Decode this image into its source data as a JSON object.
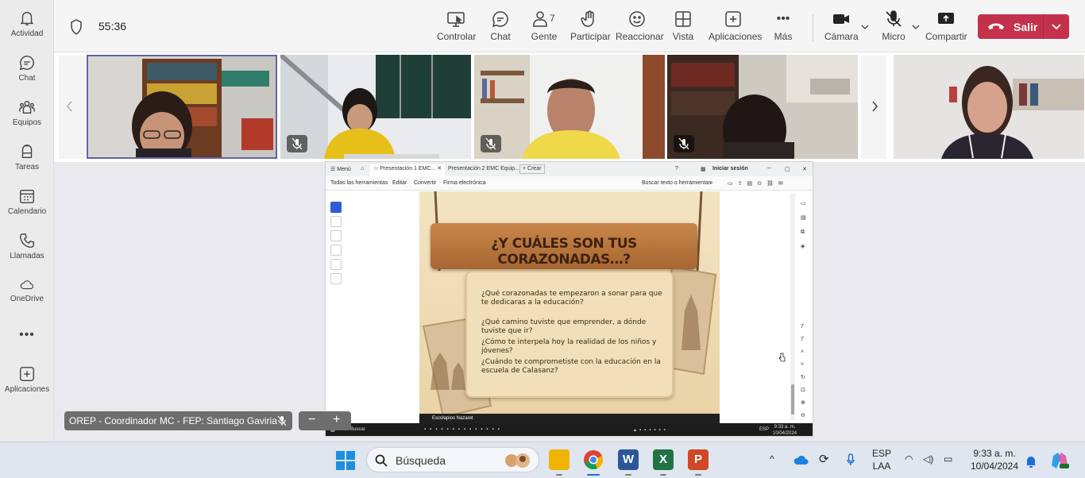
{
  "rail": {
    "items": [
      {
        "label": "Actividad",
        "icon": "bell-icon"
      },
      {
        "label": "Chat",
        "icon": "chat-icon"
      },
      {
        "label": "Equipos",
        "icon": "teams-icon"
      },
      {
        "label": "Tareas",
        "icon": "backpack-icon"
      },
      {
        "label": "Calendario",
        "icon": "calendar-icon"
      },
      {
        "label": "Llamadas",
        "icon": "phone-icon"
      },
      {
        "label": "OneDrive",
        "icon": "cloud-icon"
      },
      {
        "label": "",
        "icon": "more-icon"
      },
      {
        "label": "Aplicaciones",
        "icon": "add-app-icon"
      }
    ]
  },
  "topbar": {
    "timer": "55:36",
    "buttons": {
      "controlar": "Controlar",
      "chat": "Chat",
      "gente": "Gente",
      "gente_count": "7",
      "participar": "Participar",
      "reaccionar": "Reaccionar",
      "vista": "Vista",
      "aplicaciones": "Aplicaciones",
      "mas": "Más",
      "camara": "Cámara",
      "micro": "Micro",
      "compartir": "Compartir"
    },
    "leave": "Salir",
    "accent": "#c4314b"
  },
  "share": {
    "tabs": {
      "menu": "Menú",
      "tab1": "Presentación 1 EMC...",
      "tab2": "Presentación 2 EMC Equip...",
      "create": "Crear",
      "signin": "Iniciar sesión"
    },
    "menu": {
      "all_tools": "Todas las herramientas",
      "edit": "Editar",
      "convert": "Convertir",
      "esign": "Firma electrónica",
      "find": "Buscar texto o herramientas"
    },
    "slide": {
      "title": "¿Y CUÁLES SON TUS CORAZONADAS…?",
      "questions": [
        "¿Qué corazonadas te empezaron a sonar para que te dedicaras a la educación?",
        "¿Qué camino tuviste que emprender, a dónde tuviste que ir?",
        "¿Cómo te interpela hoy la realidad de los niños y jóvenes?",
        "¿Cuándo te comprometiste con la educación en la escuela de Calasanz?"
      ],
      "footer": "Escolapios Nazaret"
    },
    "taskbar": {
      "search": "Buscar",
      "time": "9:33 a. m.",
      "date": "10/04/2024",
      "lang": "ESP"
    }
  },
  "nameplate": {
    "name": "OREP - Coordinador MC - FEP: Santiago Gaviria"
  },
  "zoom": {
    "minus": "−",
    "plus": "+"
  },
  "taskbar": {
    "search_placeholder": "Búsqueda",
    "lang_top": "ESP",
    "lang_bottom": "LAA",
    "time": "9:33 a. m.",
    "date": "10/04/2024"
  }
}
